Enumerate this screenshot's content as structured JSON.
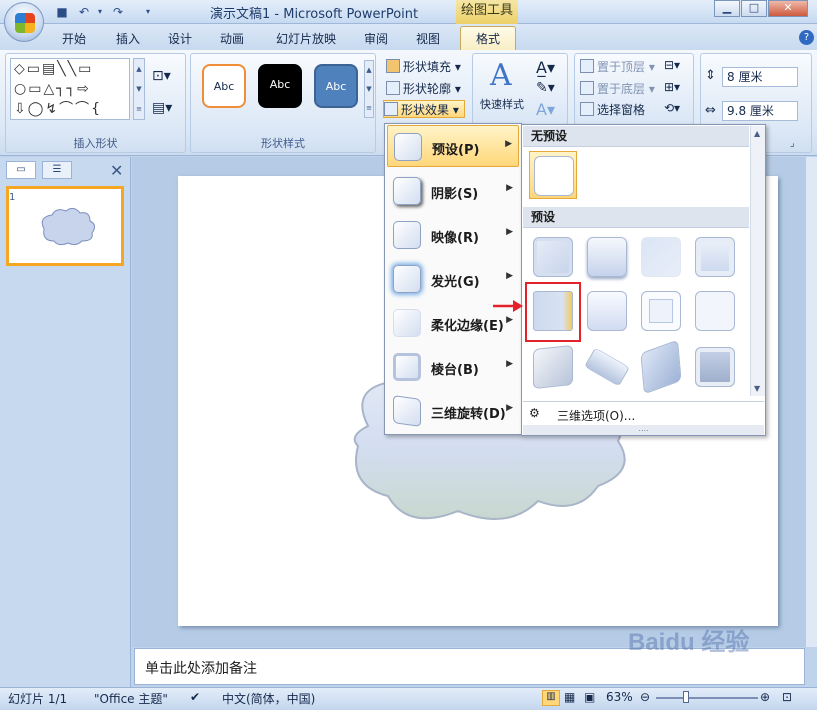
{
  "window": {
    "title": "演示文稿1 - Microsoft PowerPoint",
    "contextual_tab": "绘图工具"
  },
  "tabs": [
    "开始",
    "插入",
    "设计",
    "动画",
    "幻灯片放映",
    "审阅",
    "视图",
    "格式"
  ],
  "ribbon": {
    "insert_shapes_label": "插入形状",
    "shape_styles_label": "形状样式",
    "style_presets": [
      "Abc",
      "Abc",
      "Abc"
    ],
    "shape_fill": "形状填充",
    "shape_outline": "形状轮廓",
    "shape_effects": "形状效果",
    "quick_styles": "快速样式",
    "bring_front": "置于顶层",
    "send_back": "置于底层",
    "selection_pane": "选择窗格",
    "height_value": "8 厘米",
    "width_value": "9.8 厘米"
  },
  "effects_menu": [
    {
      "label": "预设(P)"
    },
    {
      "label": "阴影(S)"
    },
    {
      "label": "映像(R)"
    },
    {
      "label": "发光(G)"
    },
    {
      "label": "柔化边缘(E)"
    },
    {
      "label": "棱台(B)"
    },
    {
      "label": "三维旋转(D)"
    }
  ],
  "gallery": {
    "no_preset_label": "无预设",
    "preset_label": "预设",
    "options_3d": "三维选项(O)..."
  },
  "slide_pane": {
    "thumb_number": "1"
  },
  "notes_placeholder": "单击此处添加备注",
  "status": {
    "slide_info": "幻灯片 1/1",
    "theme": "\"Office 主题\"",
    "language": "中文(简体，中国)",
    "zoom": "63%"
  },
  "watermark": "Baidu 经验",
  "colors": {
    "accent_orange": "#f5a623",
    "highlight_red": "#e3222a",
    "preset_blue": "#4f81bd"
  }
}
